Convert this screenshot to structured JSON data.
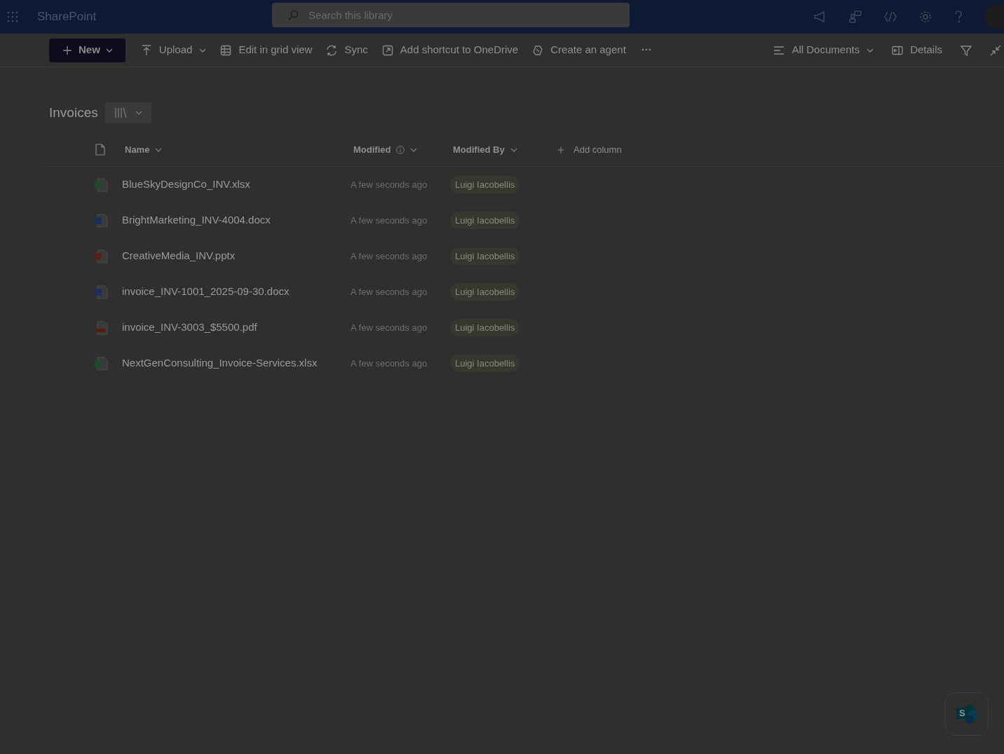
{
  "header": {
    "app_name": "SharePoint",
    "search": {
      "placeholder": "Search this library"
    }
  },
  "toolbar": {
    "left": [
      {
        "kind": "primary",
        "label": "New",
        "caret": true
      },
      {
        "kind": "command",
        "label": "Upload",
        "caret": true
      },
      {
        "kind": "command",
        "label": "Edit in grid view",
        "caret": false
      },
      {
        "kind": "command",
        "label": "Sync",
        "caret": false
      },
      {
        "kind": "command",
        "label": "Add shortcut to OneDrive",
        "caret": false
      },
      {
        "kind": "command",
        "label": "Create an agent",
        "caret": false
      },
      {
        "kind": "more",
        "label": "···",
        "caret": false
      }
    ],
    "right": [
      {
        "kind": "command",
        "label": "All Documents",
        "caret": true
      },
      {
        "kind": "command",
        "label": "Details",
        "caret": false
      }
    ]
  },
  "library": {
    "title": "Invoices"
  },
  "table": {
    "columns": [
      {
        "label": "Name",
        "info": false
      },
      {
        "label": "Modified",
        "info": true
      },
      {
        "label": "Modified By",
        "info": false
      }
    ],
    "add_column": "Add column",
    "rows": [
      {
        "kind": "excel",
        "name": "BlueSkyDesignCo_INV.xlsx",
        "modified": "A few seconds ago",
        "modified_by": "Luigi Iacobellis"
      },
      {
        "kind": "word",
        "name": "BrightMarketing_INV-4004.docx",
        "modified": "A few seconds ago",
        "modified_by": "Luigi Iacobellis"
      },
      {
        "kind": "powerpoint",
        "name": "CreativeMedia_INV.pptx",
        "modified": "A few seconds ago",
        "modified_by": "Luigi Iacobellis"
      },
      {
        "kind": "word",
        "name": "invoice_INV-1001_2025-09-30.docx",
        "modified": "A few seconds ago",
        "modified_by": "Luigi Iacobellis"
      },
      {
        "kind": "pdf",
        "name": "invoice_INV-3003_$5500.pdf",
        "modified": "A few seconds ago",
        "modified_by": "Luigi Iacobellis"
      },
      {
        "kind": "excel",
        "name": "NextGenConsulting_Invoice-Services.xlsx",
        "modified": "A few seconds ago",
        "modified_by": "Luigi Iacobellis"
      }
    ]
  },
  "fab": {
    "logo_letter": "S"
  }
}
